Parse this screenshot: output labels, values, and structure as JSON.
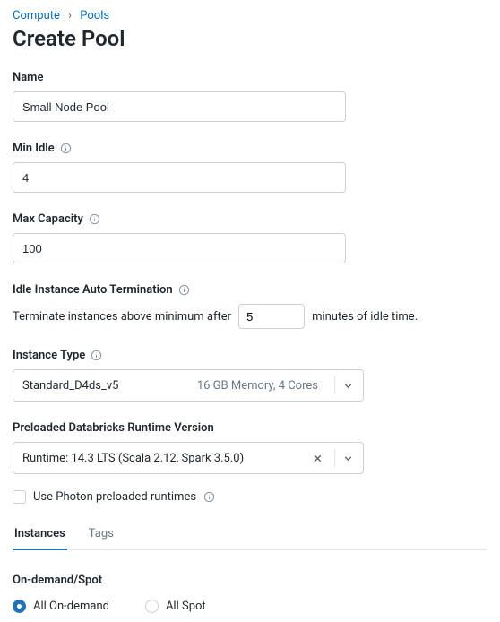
{
  "breadcrumb": {
    "parent": "Compute",
    "child": "Pools"
  },
  "page_title": "Create Pool",
  "fields": {
    "name": {
      "label": "Name",
      "value": "Small Node Pool"
    },
    "min_idle": {
      "label": "Min Idle",
      "value": "4"
    },
    "max_capacity": {
      "label": "Max Capacity",
      "value": "100"
    },
    "idle_termination": {
      "label": "Idle Instance Auto Termination",
      "prefix": "Terminate instances above minimum after",
      "value": "5",
      "suffix": "minutes of idle time."
    },
    "instance_type": {
      "label": "Instance Type",
      "value": "Standard_D4ds_v5",
      "detail": "16 GB Memory, 4 Cores"
    },
    "runtime": {
      "label": "Preloaded Databricks Runtime Version",
      "value": "Runtime: 14.3 LTS (Scala 2.12, Spark 3.5.0)"
    },
    "photon_checkbox": {
      "label": "Use Photon preloaded runtimes"
    }
  },
  "tabs": {
    "instances": "Instances",
    "tags": "Tags"
  },
  "instances_tab": {
    "section_title": "On-demand/Spot",
    "radio_on_demand": "All On-demand",
    "radio_spot": "All Spot"
  }
}
